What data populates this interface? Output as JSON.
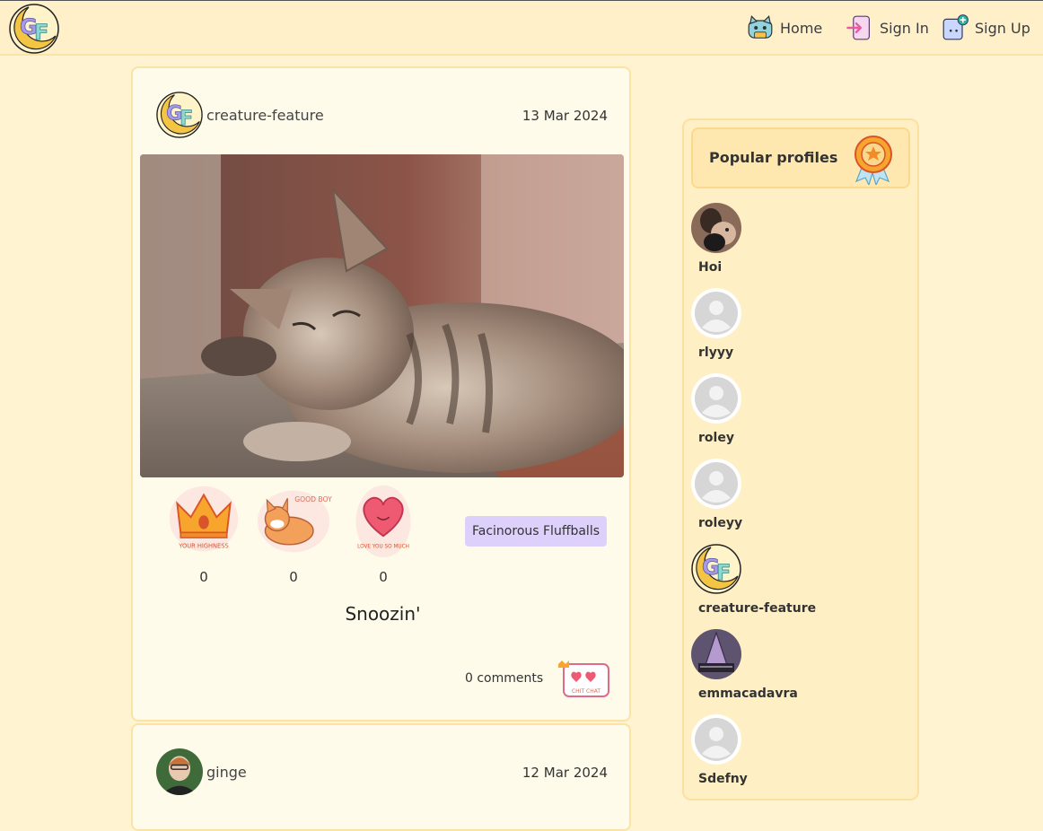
{
  "nav": {
    "logo_alt": "GF",
    "items": [
      {
        "label": "Home",
        "icon": "cat-home-icon"
      },
      {
        "label": "Sign In",
        "icon": "sign-in-icon"
      },
      {
        "label": "Sign Up",
        "icon": "sign-up-icon"
      }
    ]
  },
  "posts": [
    {
      "author": "creature-feature",
      "date": "13 Mar 2024",
      "reactions": [
        {
          "label": "YOUR HIGHNESS",
          "count": "0"
        },
        {
          "label": "GOOD BOY",
          "count": "0"
        },
        {
          "label": "LOVE YOU SO MUCH",
          "count": "0"
        }
      ],
      "category": "Facinorous Fluffballs",
      "title": "Snoozin'",
      "comments": "0 comments",
      "comment_icon_text": "CHIT CHAT"
    },
    {
      "author": "ginge",
      "date": "12 Mar 2024"
    }
  ],
  "sidebar": {
    "title": "Popular profiles",
    "profiles": [
      {
        "name": "Hoi"
      },
      {
        "name": "rlyyy"
      },
      {
        "name": "roley"
      },
      {
        "name": "roleyy"
      },
      {
        "name": "creature-feature"
      },
      {
        "name": "emmacadavra"
      },
      {
        "name": "Sdefny"
      }
    ]
  },
  "colors": {
    "background": "#fff3d1",
    "card": "#fffbea",
    "badge": "#ddd0fb",
    "accent_border": "#fbe3a3"
  }
}
